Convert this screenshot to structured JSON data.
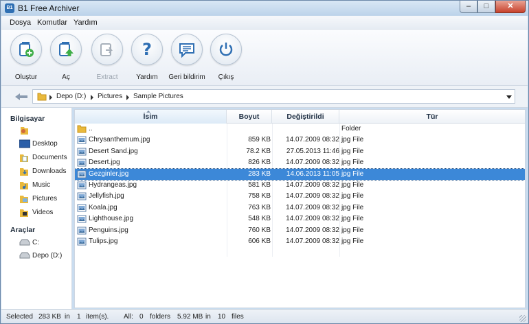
{
  "window": {
    "title": "B1 Free Archiver",
    "app_icon_text": "B1"
  },
  "menu": [
    {
      "label": "Dosya"
    },
    {
      "label": "Komutlar"
    },
    {
      "label": "Yardım"
    }
  ],
  "toolbar": [
    {
      "label": "Oluştur",
      "icon": "archive-add-icon",
      "enabled": true
    },
    {
      "label": "Aç",
      "icon": "archive-open-icon",
      "enabled": true
    },
    {
      "label": "Extract",
      "icon": "extract-icon",
      "enabled": false
    },
    {
      "label": "Yardım",
      "icon": "help-icon",
      "enabled": true
    },
    {
      "label": "Geri bildirim",
      "icon": "feedback-icon",
      "enabled": true
    },
    {
      "label": "Çıkış",
      "icon": "power-icon",
      "enabled": true
    }
  ],
  "address": {
    "crumbs": [
      "Depo (D:)",
      "Pictures",
      "Sample Pictures"
    ]
  },
  "sidebar": {
    "computer_heading": "Bilgisayar",
    "computer_items": [
      {
        "label": "",
        "icon": "user-icon"
      },
      {
        "label": "Desktop",
        "icon": "desktop-icon"
      },
      {
        "label": "Documents",
        "icon": "documents-icon"
      },
      {
        "label": "Downloads",
        "icon": "downloads-icon"
      },
      {
        "label": "Music",
        "icon": "music-icon"
      },
      {
        "label": "Pictures",
        "icon": "pictures-icon"
      },
      {
        "label": "Videos",
        "icon": "videos-icon"
      }
    ],
    "tools_heading": "Araçlar",
    "drives": [
      {
        "label": "C:",
        "icon": "drive-icon"
      },
      {
        "label": "Depo (D:)",
        "icon": "drive-icon"
      }
    ]
  },
  "columns": {
    "name": "İsim",
    "size": "Boyut",
    "date": "Değiştirildi",
    "type": "Tür"
  },
  "files": [
    {
      "name": "..",
      "size": "",
      "date": "",
      "type": "Folder",
      "icon": "folder-icon",
      "selected": false
    },
    {
      "name": "Chrysanthemum.jpg",
      "size": "859 KB",
      "date": "14.07.2009 08:32",
      "type": "jpg File",
      "icon": "image-file-icon",
      "selected": false
    },
    {
      "name": "Desert Sand.jpg",
      "size": "78.2 KB",
      "date": "27.05.2013 11:46",
      "type": "jpg File",
      "icon": "image-file-icon",
      "selected": false
    },
    {
      "name": "Desert.jpg",
      "size": "826 KB",
      "date": "14.07.2009 08:32",
      "type": "jpg File",
      "icon": "image-file-icon",
      "selected": false
    },
    {
      "name": "Gezginler.jpg",
      "size": "283 KB",
      "date": "14.06.2013 11:05",
      "type": "jpg File",
      "icon": "image-file-icon",
      "selected": true
    },
    {
      "name": "Hydrangeas.jpg",
      "size": "581 KB",
      "date": "14.07.2009 08:32",
      "type": "jpg File",
      "icon": "image-file-icon",
      "selected": false
    },
    {
      "name": "Jellyfish.jpg",
      "size": "758 KB",
      "date": "14.07.2009 08:32",
      "type": "jpg File",
      "icon": "image-file-icon",
      "selected": false
    },
    {
      "name": "Koala.jpg",
      "size": "763 KB",
      "date": "14.07.2009 08:32",
      "type": "jpg File",
      "icon": "image-file-icon",
      "selected": false
    },
    {
      "name": "Lighthouse.jpg",
      "size": "548 KB",
      "date": "14.07.2009 08:32",
      "type": "jpg File",
      "icon": "image-file-icon",
      "selected": false
    },
    {
      "name": "Penguins.jpg",
      "size": "760 KB",
      "date": "14.07.2009 08:32",
      "type": "jpg File",
      "icon": "image-file-icon",
      "selected": false
    },
    {
      "name": "Tulips.jpg",
      "size": "606 KB",
      "date": "14.07.2009 08:32",
      "type": "jpg File",
      "icon": "image-file-icon",
      "selected": false
    }
  ],
  "status": {
    "selected_label": "Selected",
    "selected_size": "283 KB",
    "in1": "in",
    "selected_count": "1",
    "items_label": "item(s).",
    "all_label": "All:",
    "folders_count": "0",
    "folders_label": "folders",
    "total_size": "5.92 MB",
    "in2": "in",
    "files_count": "10",
    "files_label": "files"
  },
  "colors": {
    "selection": "#3c88d8",
    "accent": "#2f6fb3"
  }
}
